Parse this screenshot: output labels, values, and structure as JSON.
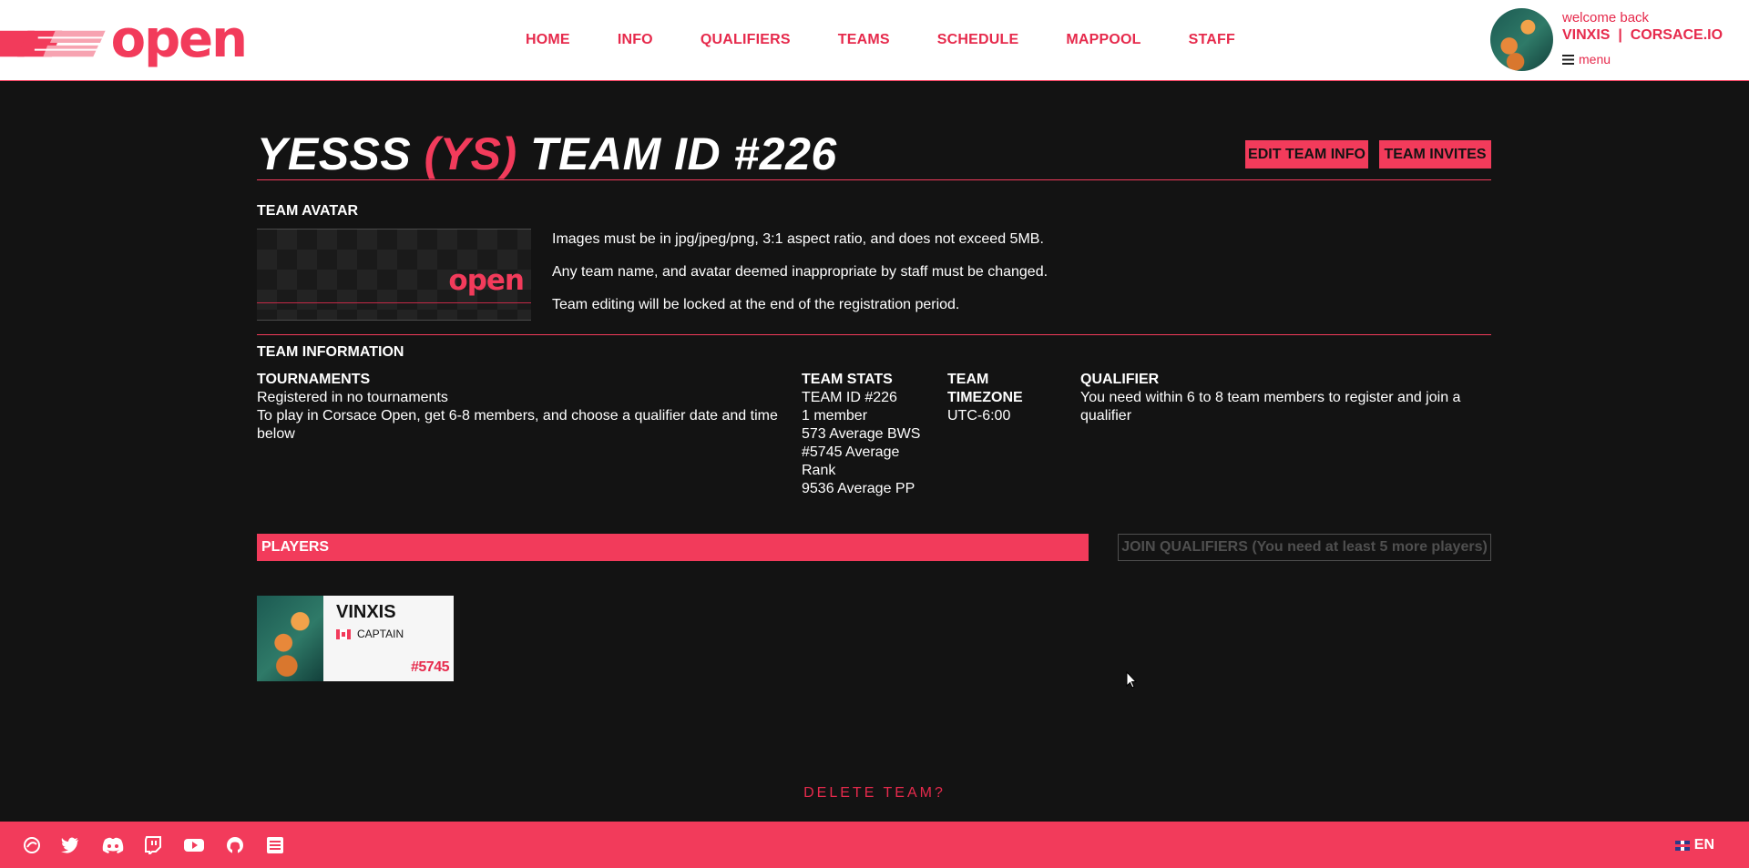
{
  "brand": {
    "logo_text": "open",
    "accent_color": "#f23b5b",
    "background_color": "#131313"
  },
  "nav": {
    "items": [
      "HOME",
      "INFO",
      "QUALIFIERS",
      "TEAMS",
      "SCHEDULE",
      "MAPPOOL",
      "STAFF"
    ]
  },
  "user": {
    "welcome": "welcome back",
    "name_line": "VINXIS  |  CORSACE.IO",
    "menu_label": "menu"
  },
  "title": {
    "team_name": "YESSS",
    "team_tag": "(YS)",
    "team_id": "TEAM ID #226"
  },
  "actions": {
    "edit_team_info": "EDIT TEAM INFO",
    "team_invites": "TEAM INVITES"
  },
  "avatar_section": {
    "label": "TEAM AVATAR",
    "avatar_text": "open",
    "rules": [
      "Images must be in jpg/jpeg/png, 3:1 aspect ratio, and does not exceed 5MB.",
      "Any team name, and avatar deemed inappropriate by staff must be changed.",
      "Team editing will be locked at the end of the registration period."
    ]
  },
  "info_section": {
    "label": "TEAM INFORMATION",
    "tournaments": {
      "heading": "TOURNAMENTS",
      "lines": [
        "Registered in no tournaments",
        "To play in Corsace Open, get 6-8 members, and choose a qualifier date and time",
        "below"
      ]
    },
    "stats": {
      "heading": "TEAM STATS",
      "lines": [
        "TEAM ID #226",
        "1 member",
        "573 Average BWS",
        "#5745 Average",
        "Rank",
        "9536 Average PP"
      ]
    },
    "timezone": {
      "heading_lines": [
        "TEAM",
        "TIMEZONE"
      ],
      "value": "UTC-6:00"
    },
    "qualifier": {
      "heading": "QUALIFIER",
      "lines": [
        "You need within 6 to 8 team members to register and join a",
        "qualifier"
      ]
    }
  },
  "players_section": {
    "label": "PLAYERS",
    "join_button": "JOIN QUALIFIERS (You need at least 5 more players)",
    "players": [
      {
        "name": "VINXIS",
        "role": "CAPTAIN",
        "country_flag": "canada-flag-icon",
        "rank": "#5745"
      }
    ]
  },
  "delete_team": "DELETE TEAM?",
  "footer": {
    "icons": [
      "osu-icon",
      "twitter-icon",
      "discord-icon",
      "twitch-icon",
      "youtube-icon",
      "github-icon",
      "sheet-icon"
    ],
    "language": "EN"
  }
}
